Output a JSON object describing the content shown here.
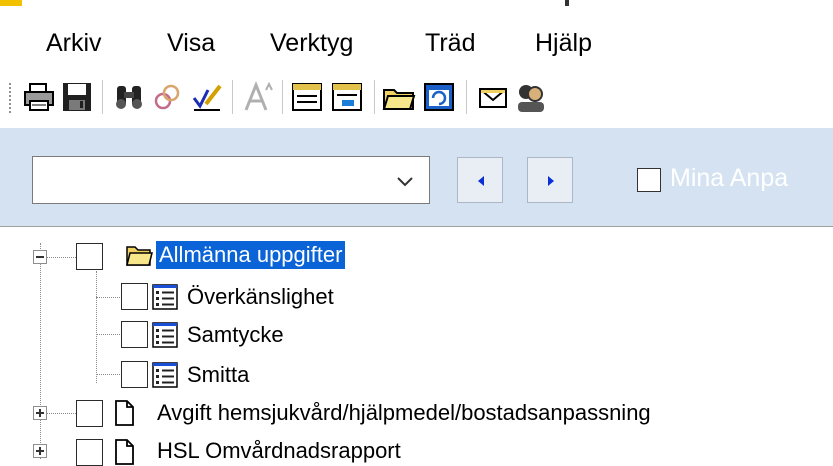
{
  "menubar": {
    "items": [
      "Arkiv",
      "Visa",
      "Verktyg",
      "Träd",
      "Hjälp"
    ]
  },
  "toolbar": {
    "buttons": [
      {
        "icon": "printer-icon"
      },
      {
        "icon": "save-icon"
      },
      {
        "icon": "binoculars-icon"
      },
      {
        "icon": "link-rings-icon"
      },
      {
        "icon": "pencil-check-icon"
      },
      {
        "icon": "font-a-icon"
      },
      {
        "icon": "window-icon"
      },
      {
        "icon": "window-list-icon"
      },
      {
        "icon": "folder-open-icon"
      },
      {
        "icon": "window-refresh-icon"
      },
      {
        "icon": "envelope-icon"
      },
      {
        "icon": "people-icon"
      }
    ]
  },
  "filter": {
    "combo_value": "",
    "mina_label": "Mina Anpa",
    "mina_checked": false
  },
  "tree": {
    "nodes": [
      {
        "label": "Allmänna uppgifter",
        "selected": true,
        "expanded": true,
        "icon": "folder-open-icon"
      },
      {
        "label": "Överkänslighet",
        "icon": "document-list-icon"
      },
      {
        "label": "Samtycke",
        "icon": "document-list-icon"
      },
      {
        "label": "Smitta",
        "icon": "document-list-icon"
      },
      {
        "label": "Avgift hemsjukvård/hjälpmedel/bostadsanpassning",
        "expanded": false,
        "icon": "document-icon"
      },
      {
        "label": "HSL Omvårdnadsrapport",
        "expanded": false,
        "icon": "document-icon"
      }
    ]
  },
  "colors": {
    "filter_bar_bg": "#d4e2f1",
    "selection_bg": "#0a64d8",
    "title_accent": "#f2c200"
  }
}
